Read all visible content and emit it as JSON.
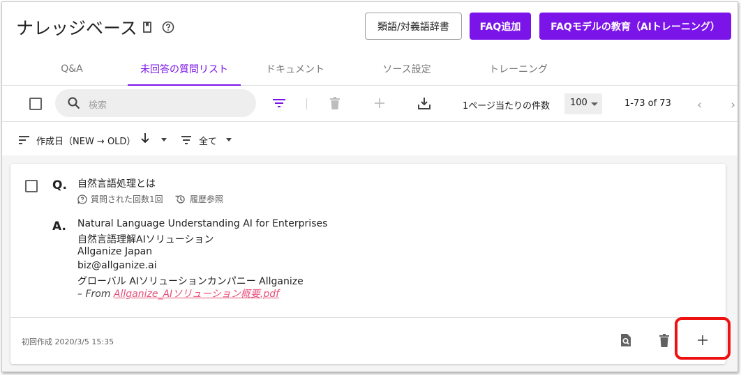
{
  "header": {
    "title": "ナレッジベース",
    "buttons": {
      "synonyms": "類語/対義語辞書",
      "add_faq": "FAQ追加",
      "train_model": "FAQモデルの教育（AIトレーニング）"
    },
    "icons": [
      "book-icon",
      "help-circle-icon"
    ]
  },
  "tabs": [
    {
      "label": "Q&A",
      "active": false
    },
    {
      "label": "未回答の質問リスト",
      "active": true
    },
    {
      "label": "ドキュメント",
      "active": false
    },
    {
      "label": "ソース設定",
      "active": false
    },
    {
      "label": "トレーニング",
      "active": false
    }
  ],
  "toolbar": {
    "search_placeholder": "検索",
    "per_page_label": "1ページ当たりの件数",
    "per_page_value": "100",
    "range": "1-73 of 73",
    "icons": [
      "filter-icon",
      "trash-icon",
      "plus-icon",
      "download-icon",
      "chevron-left-icon",
      "chevron-right-icon"
    ]
  },
  "sort": {
    "label": "作成日（NEW → OLD）",
    "filter_label": "全て"
  },
  "card": {
    "question_marker": "Q.",
    "question": "自然言語処理とは",
    "asked_count": "質問された回数1回",
    "history": "履歴参照",
    "answer_marker": "A.",
    "answer_lines": [
      "Natural Language Understanding AI for Enterprises",
      "自然言語理解AIソリューション",
      "Allganize Japan",
      "biz@allganize.ai",
      "グローバル AIソリューションカンパニー Allganize"
    ],
    "source_prefix": "– From ",
    "source_file": "Allganize_AIソリューション概要.pdf",
    "created_label": "初回作成",
    "created_date": "2020/3/5 15:35"
  },
  "colors": {
    "accent": "#7b14e8",
    "link": "#e8507a",
    "highlight": "#ee1111"
  }
}
